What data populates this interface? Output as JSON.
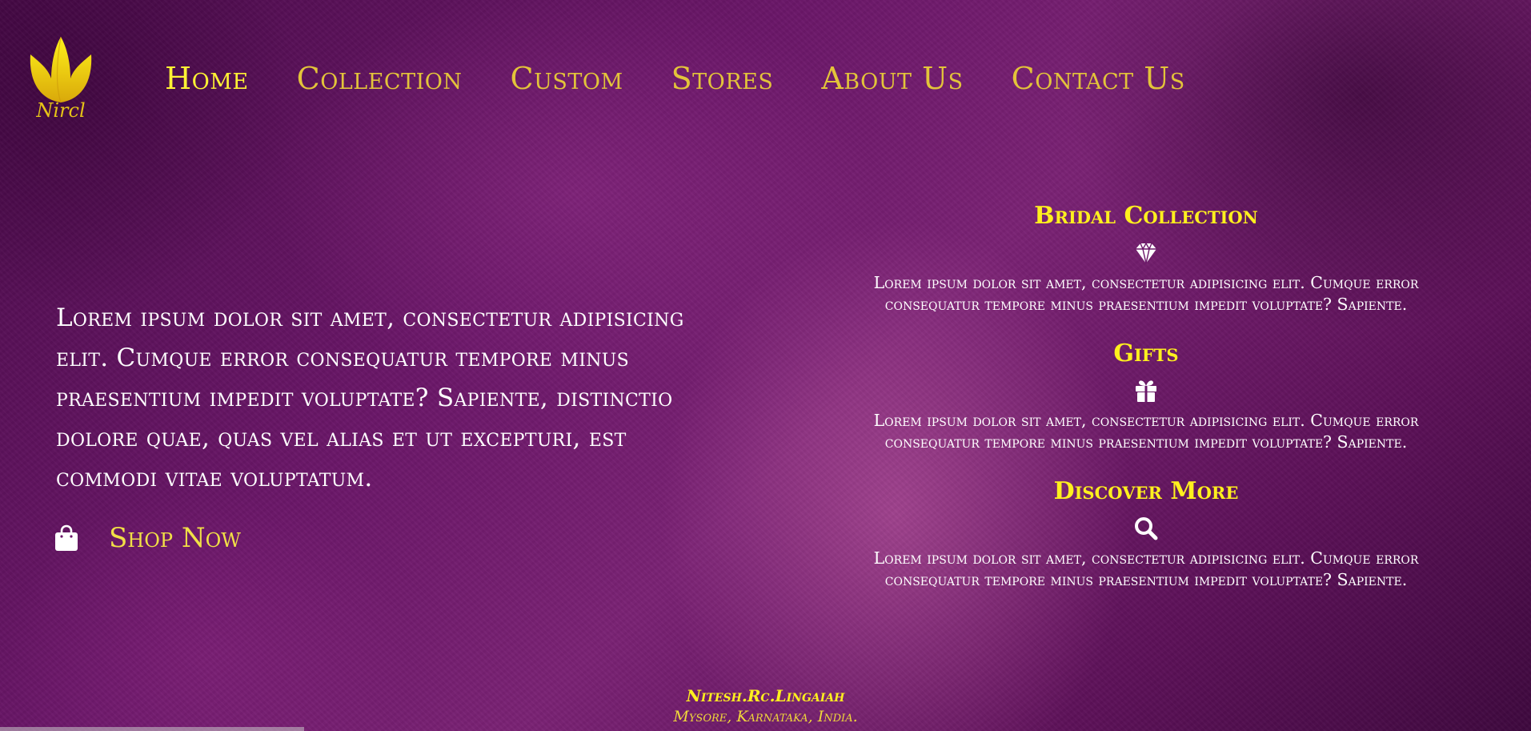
{
  "brand": {
    "logo_text": "Nircl",
    "logo_icon": "tulip-flower-icon",
    "logo_color": "#e6c417"
  },
  "nav": {
    "items": [
      {
        "label": "Home"
      },
      {
        "label": "Collection"
      },
      {
        "label": "Custom"
      },
      {
        "label": "Stores"
      },
      {
        "label": "About Us"
      },
      {
        "label": "Contact Us"
      }
    ],
    "active_color": "#fff234",
    "color": "#e3c43a"
  },
  "hero": {
    "text": "Lorem ipsum dolor sit amet, consectetur adipisicing elit. Cumque error consequatur tempore minus praesentium impedit voluptate? Sapiente, distinctio dolore quae, quas vel alias et ut excepturi, est commodi vitae voluptatum.",
    "cta_label": "Shop Now",
    "cta_icon": "shopping-bag-icon"
  },
  "features": [
    {
      "title": "Bridal Collection",
      "icon": "diamond-icon",
      "description": "Lorem ipsum dolor sit amet, consectetur adipisicing elit. Cumque error consequatur tempore minus praesentium impedit voluptate? Sapiente."
    },
    {
      "title": "Gifts",
      "icon": "gift-icon",
      "description": "Lorem ipsum dolor sit amet, consectetur adipisicing elit. Cumque error consequatur tempore minus praesentium impedit voluptate? Sapiente."
    },
    {
      "title": "Discover More",
      "icon": "search-icon",
      "description": "Lorem ipsum dolor sit amet, consectetur adipisicing elit. Cumque error consequatur tempore minus praesentium impedit voluptate? Sapiente."
    }
  ],
  "footer": {
    "name": "Nitesh.Rc.Lingaiah",
    "address": "Mysore, Karnataka, India."
  },
  "colors": {
    "accent_yellow": "#fff01e",
    "background_purple": "#6a1668"
  }
}
